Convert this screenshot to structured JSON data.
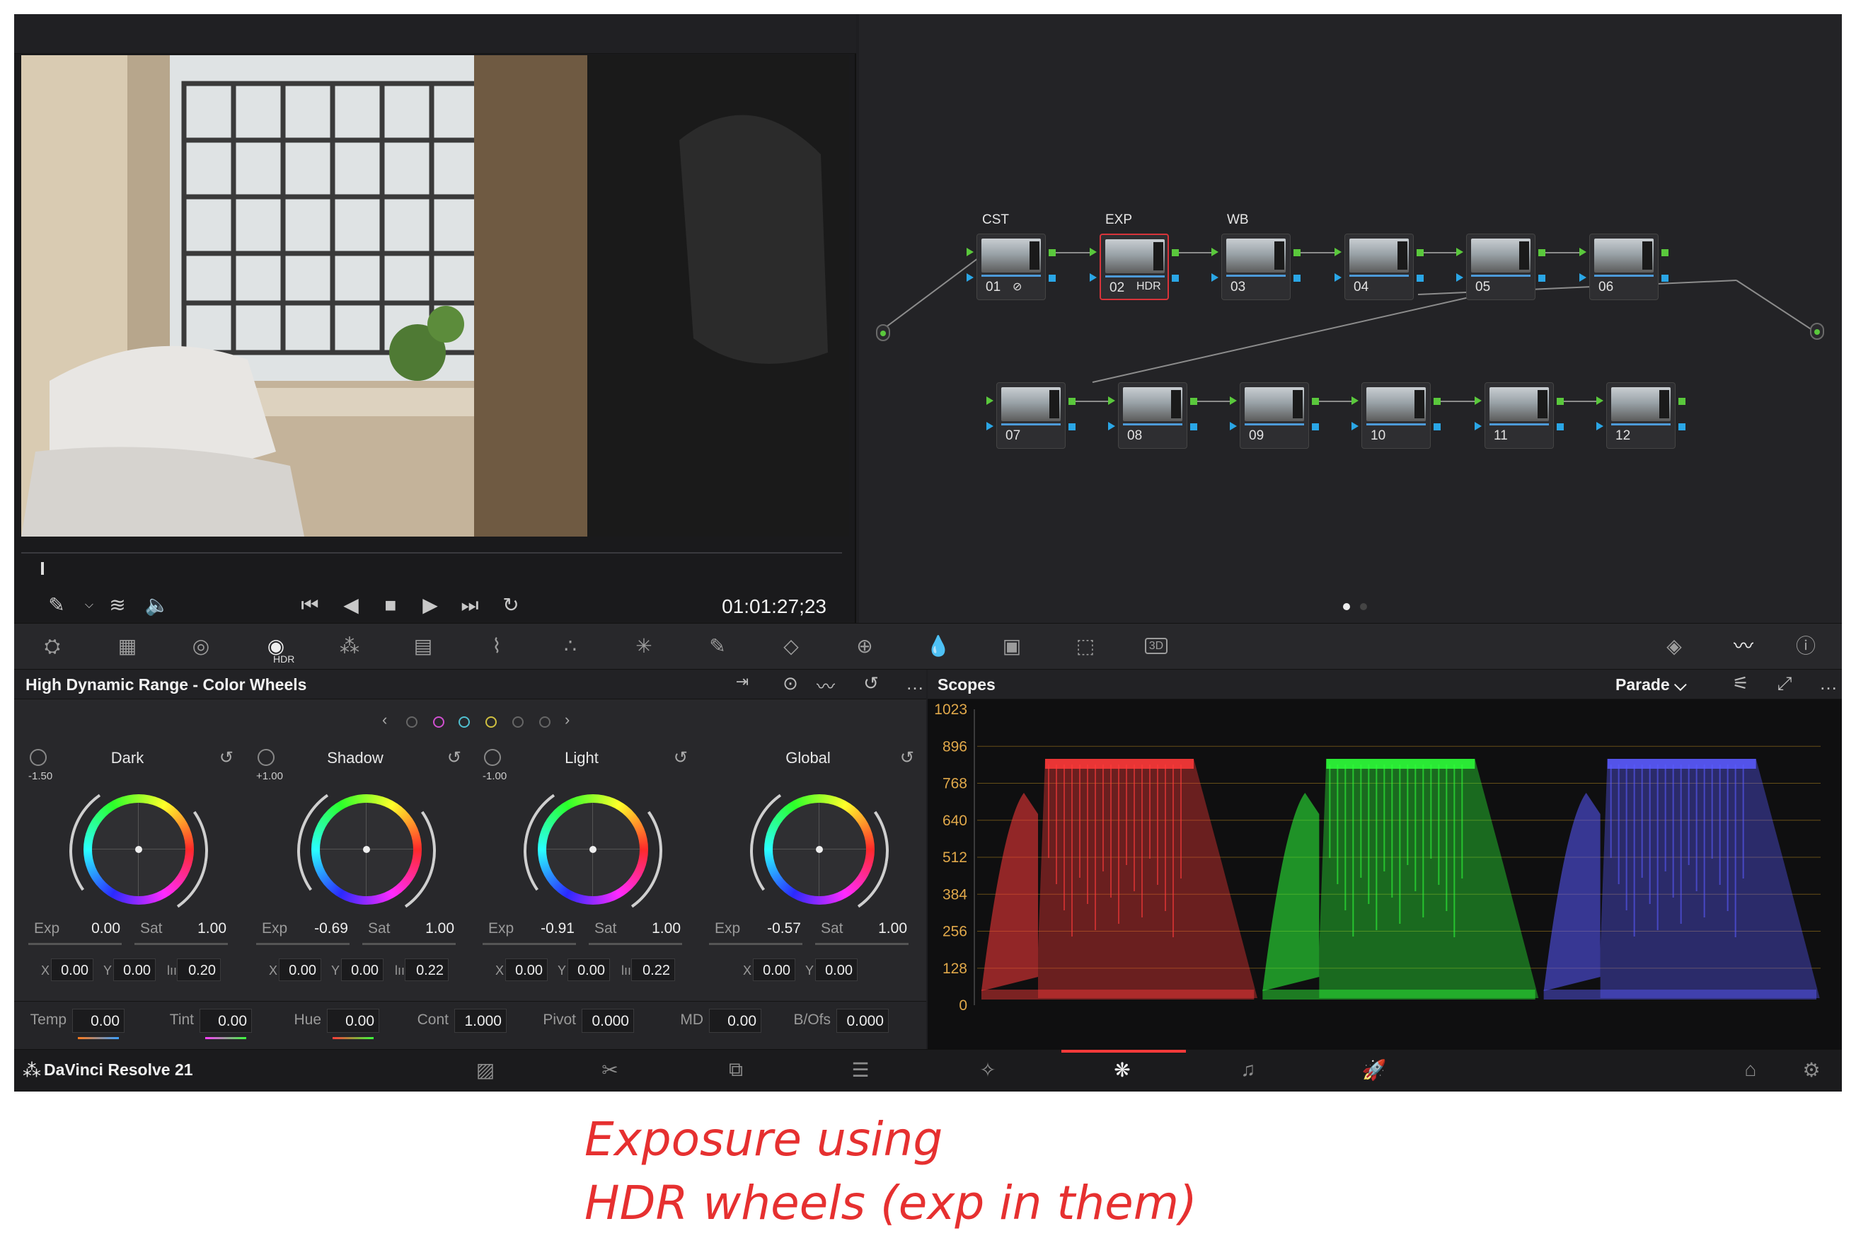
{
  "viewer": {
    "timecode": "01:01:27;23"
  },
  "nodes": [
    {
      "num": "01",
      "label": "CST",
      "icon": "⊘"
    },
    {
      "num": "02",
      "label": "EXP",
      "icon": "HDR",
      "selected": true
    },
    {
      "num": "03",
      "label": "WB",
      "icon": ""
    },
    {
      "num": "04",
      "label": "",
      "icon": ""
    },
    {
      "num": "05",
      "label": "",
      "icon": ""
    },
    {
      "num": "06",
      "label": "",
      "icon": ""
    },
    {
      "num": "07",
      "label": "",
      "icon": ""
    },
    {
      "num": "08",
      "label": "",
      "icon": ""
    },
    {
      "num": "09",
      "label": "",
      "icon": ""
    },
    {
      "num": "10",
      "label": "",
      "icon": ""
    },
    {
      "num": "11",
      "label": "",
      "icon": ""
    },
    {
      "num": "12",
      "label": "",
      "icon": ""
    }
  ],
  "toolbar": {
    "hdr_label": "HDR",
    "threed_label": "3D"
  },
  "wheels_panel": {
    "title": "High Dynamic Range - Color Wheels",
    "wheels": [
      {
        "name": "Dark",
        "knob": "-1.50",
        "exp": "0.00",
        "sat": "1.00",
        "x": "0.00",
        "y": "0.00",
        "z": "0.20"
      },
      {
        "name": "Shadow",
        "knob": "+1.00",
        "exp": "-0.69",
        "sat": "1.00",
        "x": "0.00",
        "y": "0.00",
        "z": "0.22"
      },
      {
        "name": "Light",
        "knob": "-1.00",
        "exp": "-0.91",
        "sat": "1.00",
        "x": "0.00",
        "y": "0.00",
        "z": "0.22"
      },
      {
        "name": "Global",
        "knob": "",
        "exp": "-0.57",
        "sat": "1.00",
        "x": "0.00",
        "y": "0.00",
        "z": ""
      }
    ],
    "labels": {
      "exp": "Exp",
      "sat": "Sat",
      "x": "X",
      "y": "Y"
    },
    "bottom": [
      {
        "label": "Temp",
        "value": "0.00"
      },
      {
        "label": "Tint",
        "value": "0.00"
      },
      {
        "label": "Hue",
        "value": "0.00"
      },
      {
        "label": "Cont",
        "value": "1.000"
      },
      {
        "label": "Pivot",
        "value": "0.000"
      },
      {
        "label": "MD",
        "value": "0.00"
      },
      {
        "label": "B/Ofs",
        "value": "0.000"
      }
    ]
  },
  "scopes": {
    "title": "Scopes",
    "mode": "Parade ⌵",
    "ticks": [
      "1023",
      "896",
      "768",
      "640",
      "512",
      "384",
      "256",
      "128",
      "0"
    ],
    "channel_colors": [
      "#ff3a3a",
      "#2eff3a",
      "#5a5aff"
    ]
  },
  "footer": {
    "brand": "DaVinci Resolve 21"
  },
  "caption": {
    "line1": "Exposure using",
    "line2": "HDR wheels (exp in them)"
  }
}
